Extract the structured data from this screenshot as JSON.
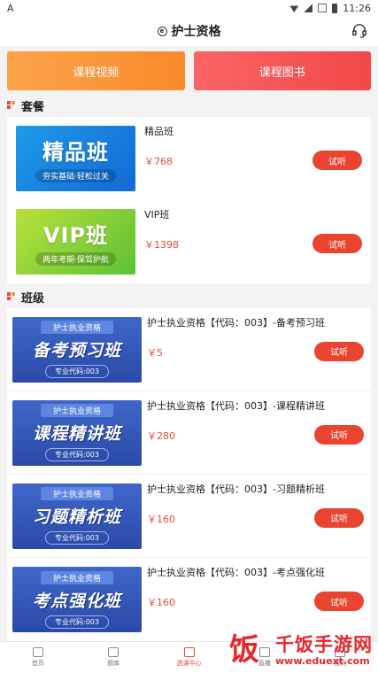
{
  "status_bar": {
    "left_icon": "A",
    "time": "11:26"
  },
  "header": {
    "title": "护士资格",
    "title_icon": "circle-e-icon",
    "right_icon": "headset-icon"
  },
  "top_buttons": [
    {
      "label": "课程视频",
      "color": "#f98a2a"
    },
    {
      "label": "课程图书",
      "color": "#f24748"
    }
  ],
  "packages": {
    "title": "套餐",
    "items": [
      {
        "name": "精品班",
        "price": "￥768",
        "button": "试听",
        "thumb_title": "精品班",
        "thumb_sub": "夯实基础·轻松过关"
      },
      {
        "name": "VIP班",
        "price": "￥1398",
        "button": "试听",
        "thumb_title": "VIP班",
        "thumb_sub": "两年考期·保驾护航"
      }
    ]
  },
  "classes": {
    "title": "班级",
    "items": [
      {
        "name": "护士执业资格【代码：003】-备考预习班",
        "price": "￥5",
        "button": "试听",
        "thumb_top": "护士执业资格",
        "thumb_title": "备考预习班",
        "thumb_code": "专业代码:003"
      },
      {
        "name": "护士执业资格【代码：003】-课程精讲班",
        "price": "￥280",
        "button": "试听",
        "thumb_top": "护士执业资格",
        "thumb_title": "课程精讲班",
        "thumb_code": "专业代码:003"
      },
      {
        "name": "护士执业资格【代码：003】-习题精析班",
        "price": "￥160",
        "button": "试听",
        "thumb_top": "护士执业资格",
        "thumb_title": "习题精析班",
        "thumb_code": "专业代码:003"
      },
      {
        "name": "护士执业资格【代码：003】-考点强化班",
        "price": "￥160",
        "button": "试听",
        "thumb_top": "护士执业资格",
        "thumb_title": "考点强化班",
        "thumb_code": "专业代码:003"
      }
    ]
  },
  "bottom_nav": [
    {
      "label": "首页",
      "icon": "home-icon"
    },
    {
      "label": "题库",
      "icon": "question-bank-icon"
    },
    {
      "label": "选课中心",
      "icon": "course-center-icon",
      "active": true
    },
    {
      "label": "直播",
      "icon": "live-icon"
    },
    {
      "label": "我的",
      "icon": "profile-icon"
    }
  ],
  "watermark": {
    "logo": "饭",
    "title": "千饭手游网",
    "url": "www.eduext.com"
  }
}
